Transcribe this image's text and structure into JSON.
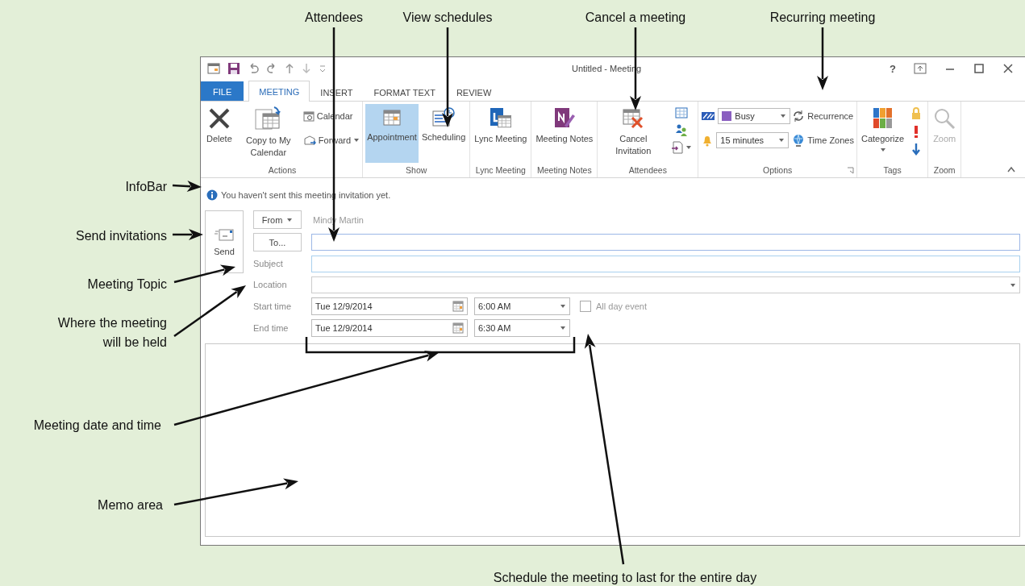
{
  "callouts": [
    {
      "text": "Attendees"
    },
    {
      "text": "View schedules"
    },
    {
      "text": "Cancel a meeting"
    },
    {
      "text": "Recurring meeting"
    },
    {
      "text": "InfoBar"
    },
    {
      "text": "Send invitations"
    },
    {
      "text": "Meeting Topic"
    },
    {
      "text": "Where the meeting will be held"
    },
    {
      "text": "Meeting date and time"
    },
    {
      "text": "Memo area"
    },
    {
      "text": "Schedule the meeting to last for the entire day"
    }
  ],
  "window": {
    "title": "Untitled - Meeting",
    "help": "?"
  },
  "tabs": [
    {
      "label": "FILE",
      "kind": "file",
      "selected": false
    },
    {
      "label": "MEETING",
      "kind": "tab",
      "selected": true
    },
    {
      "label": "INSERT",
      "kind": "tab",
      "selected": false
    },
    {
      "label": "FORMAT TEXT",
      "kind": "tab",
      "selected": false
    },
    {
      "label": "REVIEW",
      "kind": "tab",
      "selected": false
    }
  ],
  "ribbon": {
    "groups": [
      {
        "label": "Actions",
        "items": [
          {
            "kind": "large",
            "label": "Delete",
            "selected": false,
            "disabled": false
          },
          {
            "kind": "large",
            "label": "Copy to My Calendar",
            "selected": false,
            "disabled": false
          },
          {
            "kind": "stack",
            "items": [
              {
                "kind": "small",
                "label": "Calendar",
                "dropdown": false
              },
              {
                "kind": "small",
                "label": "Forward",
                "dropdown": true
              }
            ]
          }
        ]
      },
      {
        "label": "Show",
        "items": [
          {
            "kind": "large",
            "label": "Appointment",
            "selected": true,
            "disabled": false
          },
          {
            "kind": "large",
            "label": "Scheduling",
            "selected": false,
            "disabled": false
          }
        ]
      },
      {
        "label": "Lync Meeting",
        "items": [
          {
            "kind": "large",
            "label": "Lync Meeting",
            "selected": false,
            "disabled": false
          }
        ]
      },
      {
        "label": "Meeting Notes",
        "items": [
          {
            "kind": "large",
            "label": "Meeting Notes",
            "selected": false,
            "disabled": false
          }
        ]
      },
      {
        "label": "Attendees",
        "items": [
          {
            "kind": "large",
            "label": "Cancel Invitation",
            "selected": false,
            "disabled": false
          },
          {
            "kind": "icons"
          }
        ]
      },
      {
        "label": "Options",
        "items": [
          {
            "kind": "stack",
            "items": [
              {
                "kind": "select",
                "value": "Busy"
              },
              {
                "kind": "select",
                "value": "15 minutes"
              }
            ]
          },
          {
            "kind": "stack",
            "items": [
              {
                "kind": "small",
                "label": "Recurrence",
                "dropdown": false
              },
              {
                "kind": "small",
                "label": "Time Zones",
                "dropdown": false
              }
            ]
          }
        ]
      },
      {
        "label": "Tags",
        "items": [
          {
            "kind": "large",
            "label": "Categorize",
            "selected": false,
            "disabled": false
          },
          {
            "kind": "icons"
          }
        ]
      },
      {
        "label": "Zoom",
        "items": [
          {
            "kind": "large",
            "label": "Zoom",
            "selected": false,
            "disabled": true
          }
        ]
      }
    ]
  },
  "infobar": {
    "text": "You haven't sent this meeting invitation yet."
  },
  "send": {
    "label": "Send"
  },
  "form": {
    "from_button": "From",
    "from_value": "Mindy Martin",
    "to_button": "To...",
    "subject_label": "Subject",
    "location_label": "Location",
    "start": {
      "label": "Start time",
      "date": "Tue 12/9/2014",
      "time": "6:00 AM"
    },
    "end": {
      "label": "End time",
      "date": "Tue 12/9/2014",
      "time": "6:30 AM"
    },
    "all_day": {
      "label": "All day event",
      "checked": false
    }
  }
}
